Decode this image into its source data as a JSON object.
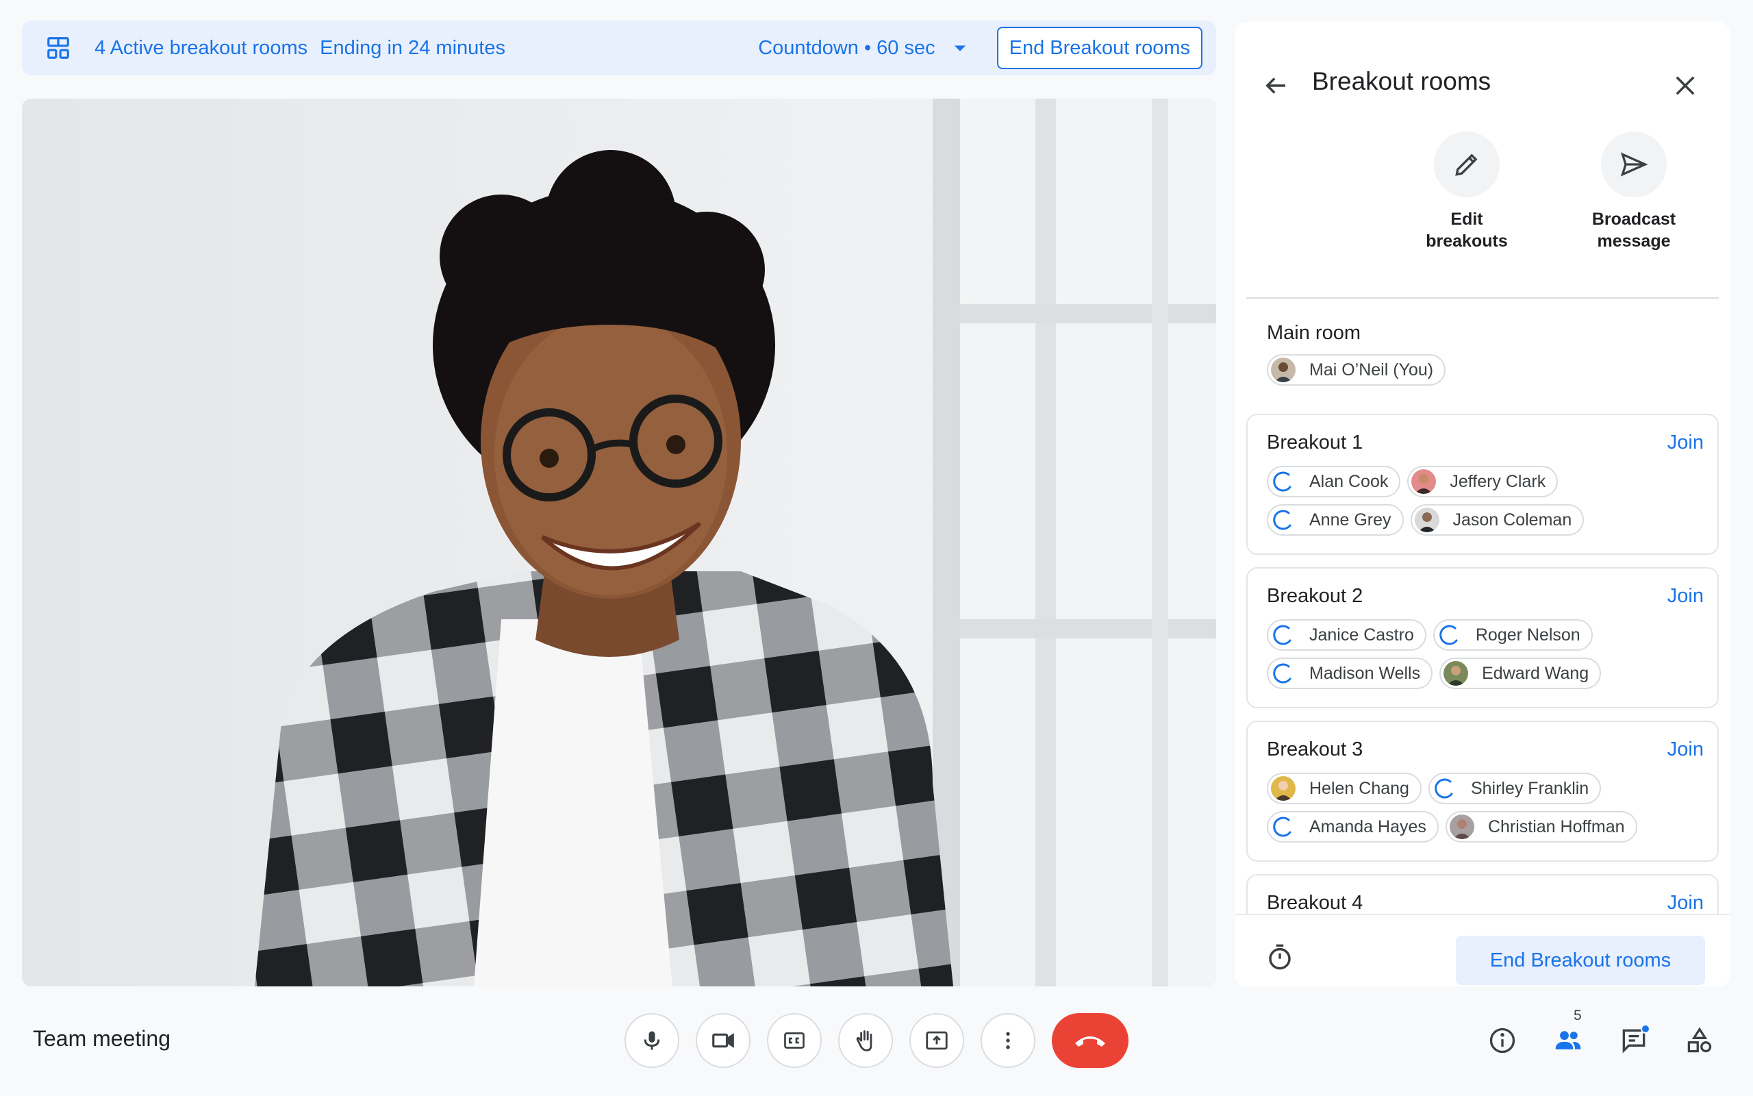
{
  "banner": {
    "active_rooms": "4 Active breakout rooms",
    "ending": "Ending in 24 minutes",
    "countdown": "Countdown • 60 sec",
    "end_button": "End Breakout rooms"
  },
  "panel": {
    "title": "Breakout rooms",
    "actions": [
      {
        "line1": "Edit",
        "line2": "breakouts"
      },
      {
        "line1": "Broadcast",
        "line2": "message"
      }
    ],
    "main_room": {
      "title": "Main room",
      "participants": [
        {
          "name": "Mai O’Neil (You)"
        }
      ]
    },
    "rooms": [
      {
        "title": "Breakout 1",
        "join": "Join",
        "participants": [
          {
            "name": "Alan Cook"
          },
          {
            "name": "Jeffery Clark"
          },
          {
            "name": "Anne Grey"
          },
          {
            "name": "Jason Coleman"
          }
        ]
      },
      {
        "title": "Breakout 2",
        "join": "Join",
        "participants": [
          {
            "name": "Janice Castro"
          },
          {
            "name": "Roger Nelson"
          },
          {
            "name": "Madison Wells"
          },
          {
            "name": "Edward Wang"
          }
        ]
      },
      {
        "title": "Breakout 3",
        "join": "Join",
        "participants": [
          {
            "name": "Helen Chang"
          },
          {
            "name": "Shirley Franklin"
          },
          {
            "name": "Amanda Hayes"
          },
          {
            "name": "Christian Hoffman"
          }
        ]
      },
      {
        "title": "Breakout 4",
        "join": "Join"
      }
    ],
    "footer_button": "End Breakout rooms"
  },
  "meeting": {
    "title": "Team meeting"
  },
  "toolbar": {
    "people_count": "5"
  },
  "colors": {
    "accent": "#1a73e8",
    "accent_bg": "#e8f0fe",
    "end_call": "#ea4335"
  }
}
